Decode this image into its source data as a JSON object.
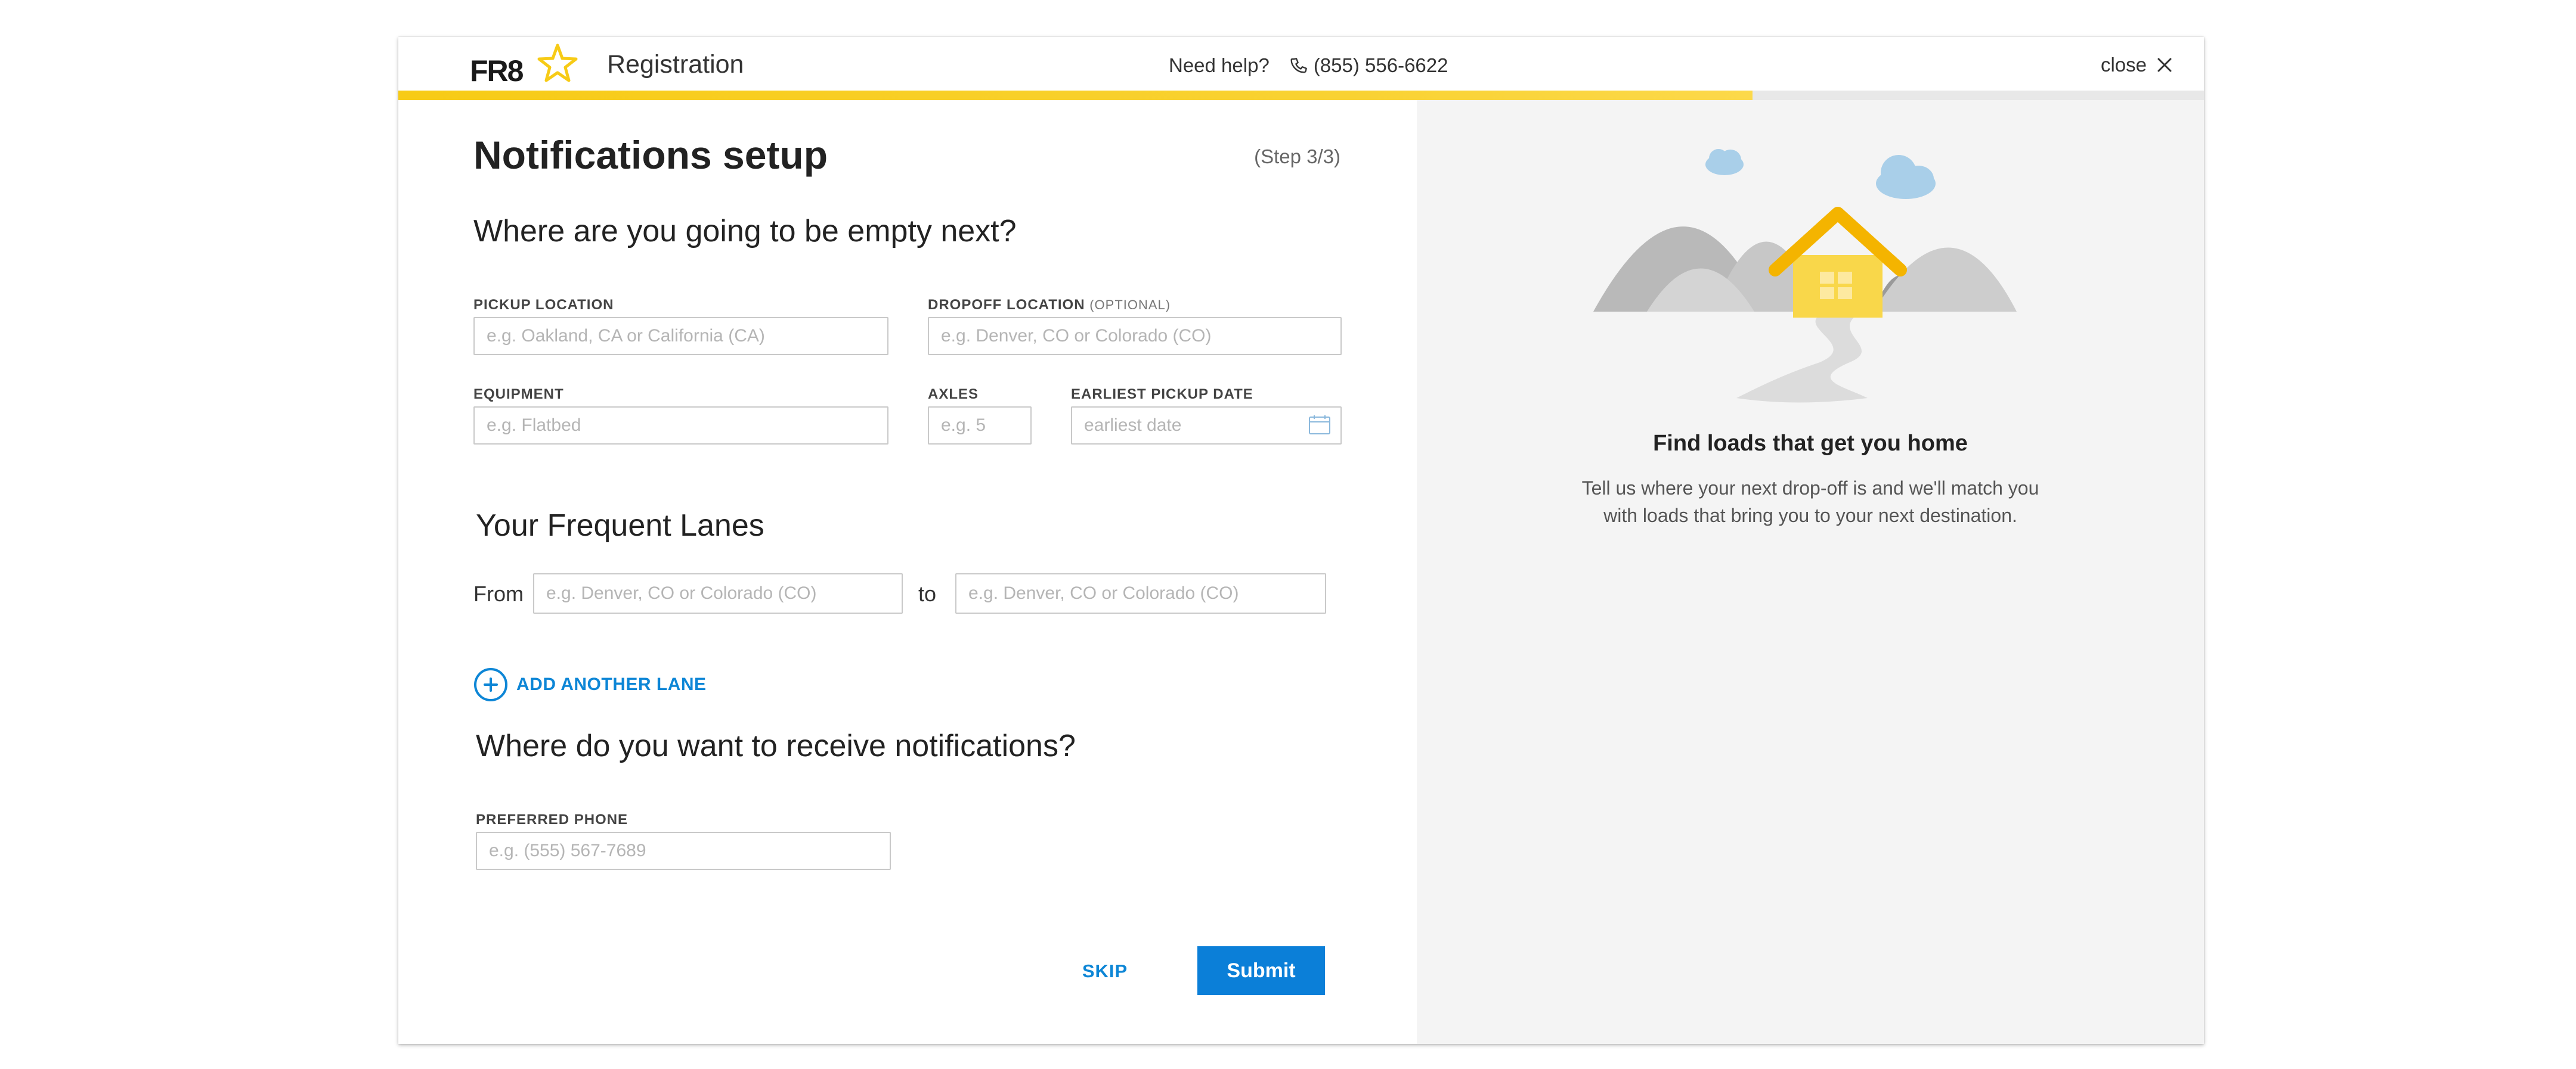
{
  "header": {
    "logo_text": "FR8",
    "title": "Registration",
    "help_label": "Need help?",
    "phone": "(855) 556-6622",
    "close_label": "close",
    "progress_percent": 75,
    "accent_color": "#f7cb16"
  },
  "form": {
    "title": "Notifications setup",
    "step": "(Step 3/3)",
    "empty_section": {
      "heading": "Where are you going to be empty next?",
      "pickup_label": "PICKUP LOCATION",
      "pickup_placeholder": "e.g. Oakland, CA or California (CA)",
      "dropoff_label": "DROPOFF LOCATION",
      "dropoff_optional": "(OPTIONAL)",
      "dropoff_placeholder": "e.g. Denver, CO or Colorado (CO)",
      "equipment_label": "EQUIPMENT",
      "equipment_placeholder": "e.g. Flatbed",
      "axles_label": "AXLES",
      "axles_placeholder": "e.g. 5",
      "date_label": "EARLIEST PICKUP DATE",
      "date_placeholder": "earliest date"
    },
    "lanes_section": {
      "heading": "Your Frequent Lanes",
      "from_label": "From",
      "from_placeholder": "e.g. Denver, CO or Colorado (CO)",
      "to_label": "to",
      "to_placeholder": "e.g. Denver, CO or Colorado (CO)",
      "add_lane_label": "ADD ANOTHER LANE"
    },
    "notify_section": {
      "heading": "Where do you want to receive notifications?",
      "phone_label": "PREFERRED PHONE",
      "phone_placeholder": "e.g. (555) 567-7689"
    },
    "skip_label": "SKIP",
    "submit_label": "Submit",
    "primary_color": "#0b7fd8"
  },
  "side": {
    "title": "Find loads that get you home",
    "description": "Tell us where your next drop-off is and we'll match you with loads that bring you to your next destination.",
    "illustration": "house-mountains-illustration"
  }
}
